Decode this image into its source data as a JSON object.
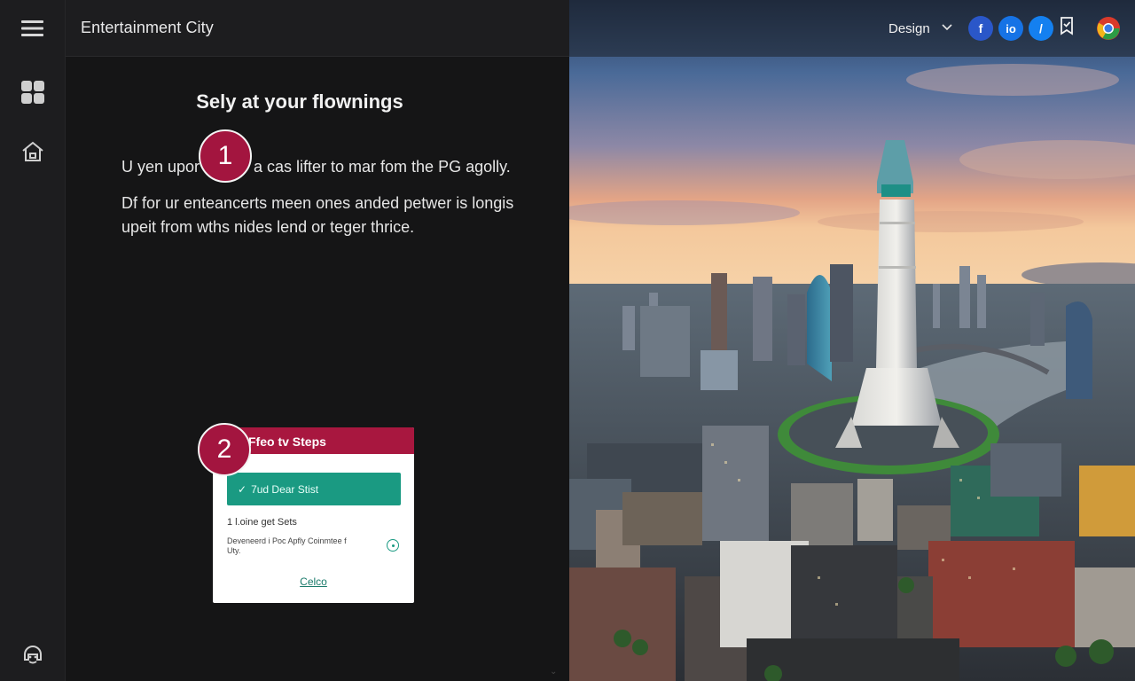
{
  "app": {
    "title": "Entertainment City"
  },
  "rail": {
    "icons": [
      "menu-icon",
      "dashboard-grid-icon",
      "home-icon",
      "support-icon"
    ]
  },
  "content": {
    "heading": "Sely at your flownings",
    "para1_before": "U yen upor",
    "para1_after": "a cas lifter to mar fom the PG agolly.",
    "para2": "Df for ur enteancerts meen ones anded petwer is longis upeit from wths nides lend or teger thrice.",
    "badge1": "1",
    "badge2": "2"
  },
  "card": {
    "title": "Ffeo tv Steps",
    "button_label": "7ud Dear Stist",
    "line1": "1 l.oine get Sets",
    "line2": "Deveneerd i Poc Apfly Coinmtee f Uty.",
    "link": "Celco"
  },
  "header_right": {
    "menu_label": "Design",
    "social": [
      {
        "name": "facebook-icon",
        "glyph": "f",
        "color": "#2a57c9"
      },
      {
        "name": "io-icon",
        "glyph": "io",
        "color": "#1673e6"
      },
      {
        "name": "edit-icon",
        "glyph": "/",
        "color": "#1480f0"
      },
      {
        "name": "badge-icon",
        "glyph": "",
        "color": "transparent"
      },
      {
        "name": "chrome-icon",
        "glyph": "",
        "color": "#e34133"
      }
    ]
  },
  "colors": {
    "accent": "#a3153f",
    "teal": "#1a9a82"
  }
}
